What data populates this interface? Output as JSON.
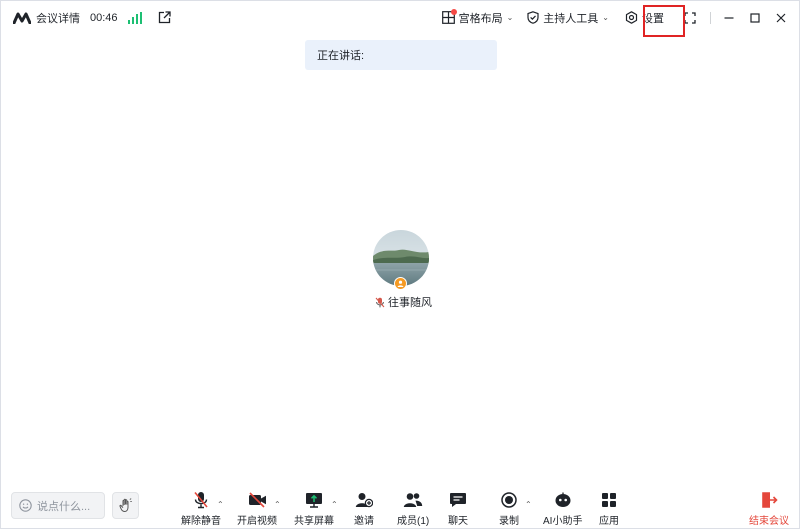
{
  "topbar": {
    "title": "会议详情",
    "timer": "00:46",
    "layout_label": "宫格布局",
    "host_tools_label": "主持人工具",
    "settings_label": "设置"
  },
  "speaking": {
    "label": "正在讲话:"
  },
  "participant": {
    "name": "往事随风"
  },
  "chat": {
    "placeholder": "说点什么..."
  },
  "toolbar": {
    "unmute": "解除静音",
    "start_video": "开启视频",
    "share_screen": "共享屏幕",
    "invite": "邀请",
    "members": "成员(1)",
    "chat": "聊天",
    "record": "录制",
    "ai_assistant": "AI小助手",
    "apps": "应用",
    "end_meeting": "结束会议"
  },
  "colors": {
    "accent_green": "#1dbf73",
    "end_red": "#e4473b",
    "host_orange": "#f59a23",
    "banner_bg": "#eaf1fb"
  }
}
